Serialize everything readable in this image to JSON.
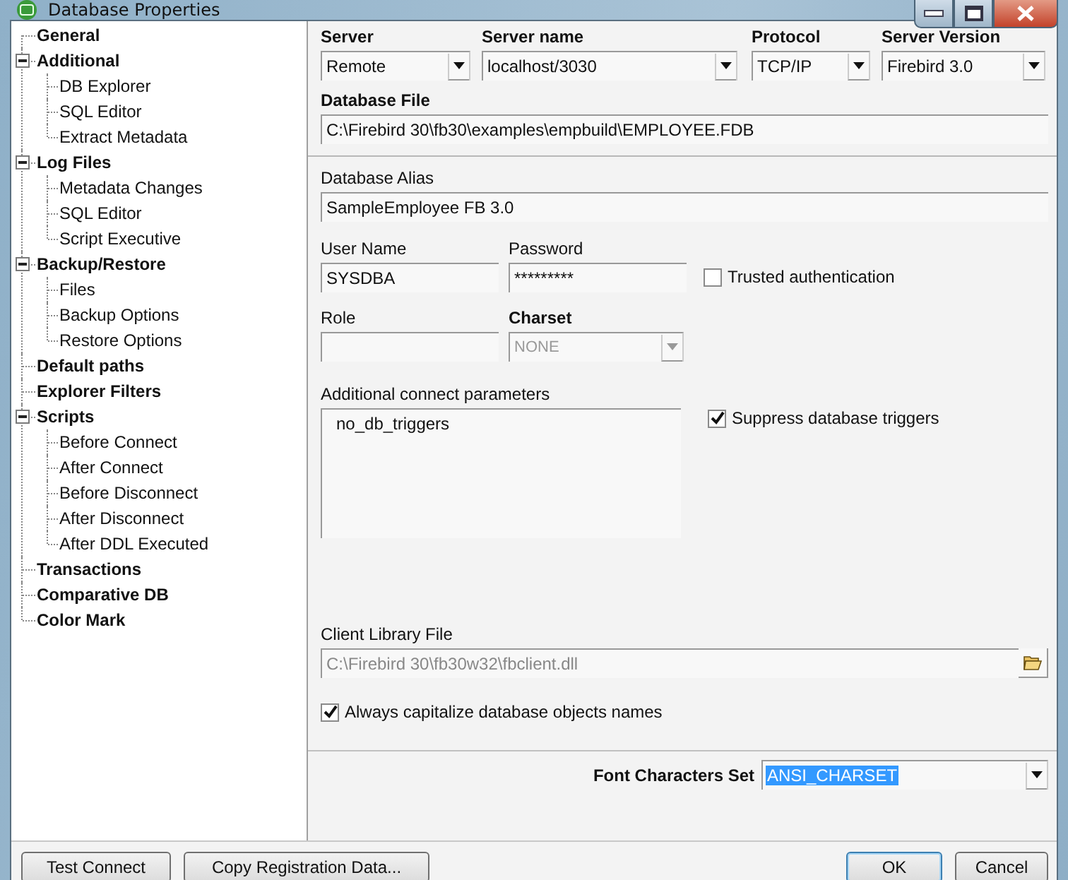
{
  "window": {
    "title": "Database Properties"
  },
  "tree": [
    {
      "label": "General"
    },
    {
      "label": "Additional",
      "expanded": true,
      "children": [
        {
          "label": "DB Explorer"
        },
        {
          "label": "SQL Editor"
        },
        {
          "label": "Extract Metadata"
        }
      ]
    },
    {
      "label": "Log Files",
      "expanded": true,
      "children": [
        {
          "label": "Metadata Changes"
        },
        {
          "label": "SQL Editor"
        },
        {
          "label": "Script Executive"
        }
      ]
    },
    {
      "label": "Backup/Restore",
      "expanded": true,
      "children": [
        {
          "label": "Files"
        },
        {
          "label": "Backup Options"
        },
        {
          "label": "Restore Options"
        }
      ]
    },
    {
      "label": "Default paths"
    },
    {
      "label": "Explorer Filters"
    },
    {
      "label": "Scripts",
      "expanded": true,
      "children": [
        {
          "label": "Before Connect"
        },
        {
          "label": "After Connect"
        },
        {
          "label": "Before Disconnect"
        },
        {
          "label": "After Disconnect"
        },
        {
          "label": "After DDL Executed"
        }
      ]
    },
    {
      "label": "Transactions"
    },
    {
      "label": "Comparative DB"
    },
    {
      "label": "Color Mark"
    }
  ],
  "server": {
    "label": "Server",
    "value": "Remote"
  },
  "server_name": {
    "label": "Server name",
    "value": "localhost/3030"
  },
  "protocol": {
    "label": "Protocol",
    "value": "TCP/IP"
  },
  "server_version": {
    "label": "Server Version",
    "value": "Firebird 3.0"
  },
  "database_file": {
    "label": "Database File",
    "value": "C:\\Firebird 30\\fb30\\examples\\empbuild\\EMPLOYEE.FDB"
  },
  "database_alias": {
    "label": "Database Alias",
    "value": "SampleEmployee FB 3.0"
  },
  "user_name": {
    "label": "User Name",
    "value": "SYSDBA"
  },
  "password": {
    "label": "Password",
    "value": "*********"
  },
  "trusted_authentication": {
    "label": "Trusted authentication",
    "checked": false
  },
  "role": {
    "label": "Role"
  },
  "charset": {
    "label": "Charset",
    "value": "NONE",
    "disabled": true
  },
  "connect_parameters": {
    "label": "Additional connect parameters",
    "value": "no_db_triggers"
  },
  "suppress_triggers": {
    "label": "Suppress database triggers",
    "checked": true
  },
  "client_library": {
    "label": "Client Library File",
    "value": "C:\\Firebird 30\\fb30w32\\fbclient.dll",
    "disabled": true
  },
  "capitalize_names": {
    "label": "Always capitalize database objects names",
    "checked": true
  },
  "font_charset": {
    "label": "Font Characters Set",
    "value": "ANSI_CHARSET",
    "highlighted": true
  },
  "buttons_left": [
    "Test Connect",
    "Copy Registration Data..."
  ],
  "buttons_right": [
    {
      "label": "OK",
      "default": true
    },
    {
      "label": "Cancel",
      "default": false
    }
  ]
}
